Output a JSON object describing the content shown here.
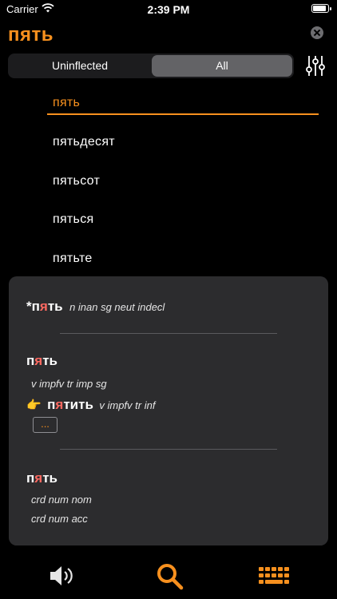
{
  "status": {
    "carrier": "Carrier",
    "time": "2:39 PM"
  },
  "search": {
    "query": "пять"
  },
  "segmented": {
    "left": "Uninflected",
    "right": "All",
    "selected": "All"
  },
  "results": [
    "пять",
    "пятьдесят",
    "пятьсот",
    "пяться",
    "пятьте"
  ],
  "entries": {
    "e1": {
      "star": "*",
      "pre": "п",
      "stress": "я",
      "post": "ть",
      "gram": "n inan sg neut indecl"
    },
    "e2": {
      "pre": "п",
      "stress": "я",
      "post": "ть",
      "gram": "v impfv tr imp sg",
      "pointer": "👉",
      "lemma_pre": "п",
      "lemma_stress": "я",
      "lemma_post": "тить",
      "lemma_gram": "v impfv tr inf",
      "more": "..."
    },
    "e3": {
      "pre": "п",
      "stress": "я",
      "post": "ть",
      "gram1": "crd num nom",
      "gram2": "crd num acc"
    }
  },
  "toolbar": [
    "speaker-icon",
    "search-icon",
    "keyboard-icon"
  ],
  "colors": {
    "accent": "#f7901e",
    "stress": "#ff6961",
    "panel": "#2c2c2e"
  }
}
